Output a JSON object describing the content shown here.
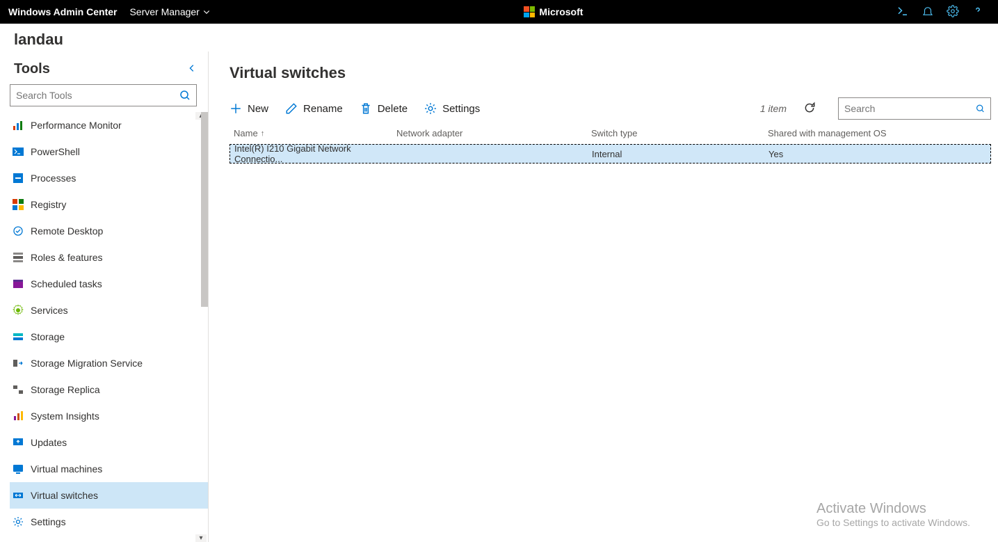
{
  "topbar": {
    "title": "Windows Admin Center",
    "context": "Server Manager",
    "brand": "Microsoft"
  },
  "server": {
    "name": "landau"
  },
  "tools": {
    "heading": "Tools",
    "search_placeholder": "Search Tools",
    "items": [
      {
        "label": "Performance Monitor"
      },
      {
        "label": "PowerShell"
      },
      {
        "label": "Processes"
      },
      {
        "label": "Registry"
      },
      {
        "label": "Remote Desktop"
      },
      {
        "label": "Roles & features"
      },
      {
        "label": "Scheduled tasks"
      },
      {
        "label": "Services"
      },
      {
        "label": "Storage"
      },
      {
        "label": "Storage Migration Service"
      },
      {
        "label": "Storage Replica"
      },
      {
        "label": "System Insights"
      },
      {
        "label": "Updates"
      },
      {
        "label": "Virtual machines"
      },
      {
        "label": "Virtual switches",
        "selected": true
      },
      {
        "label": "Settings"
      }
    ]
  },
  "main": {
    "heading": "Virtual switches",
    "toolbar": {
      "new": "New",
      "rename": "Rename",
      "delete": "Delete",
      "settings": "Settings",
      "count": "1 item",
      "search_placeholder": "Search"
    },
    "columns": {
      "name": "Name",
      "adapter": "Network adapter",
      "type": "Switch type",
      "shared": "Shared with management OS"
    },
    "rows": [
      {
        "name": "Intel(R) I210 Gigabit Network Connectio...",
        "adapter": "",
        "type": "Internal",
        "shared": "Yes"
      }
    ]
  },
  "watermark": {
    "title": "Activate Windows",
    "sub": "Go to Settings to activate Windows."
  }
}
